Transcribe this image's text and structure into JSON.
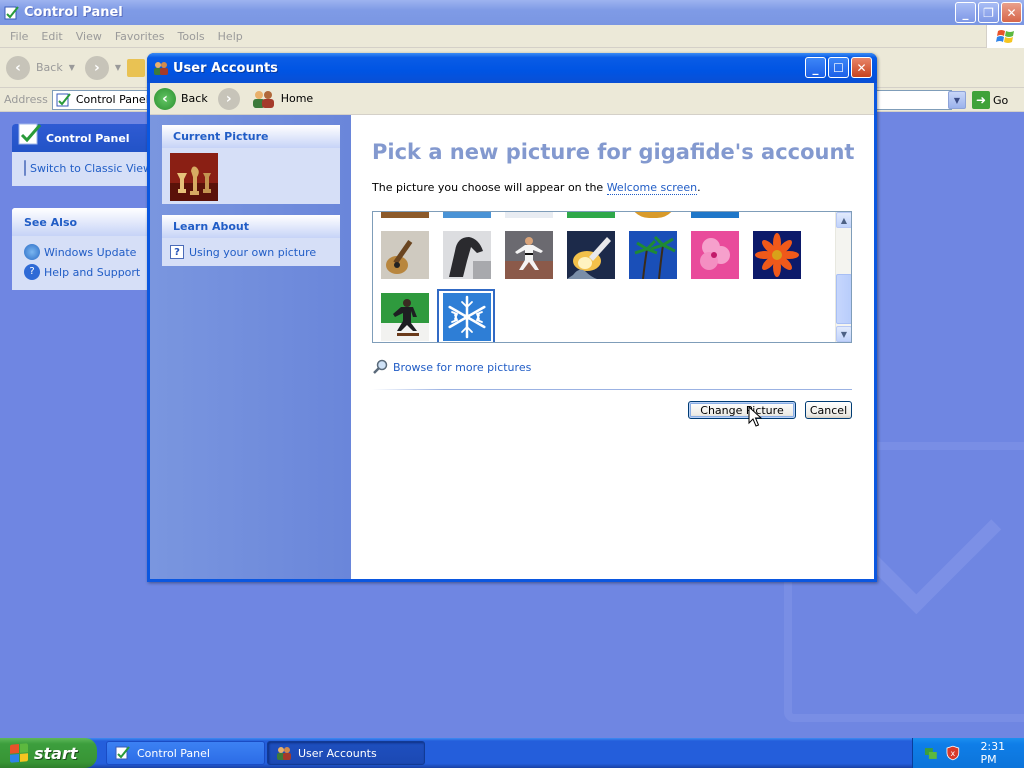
{
  "control_panel": {
    "title": "Control Panel",
    "menu": [
      "File",
      "Edit",
      "View",
      "Favorites",
      "Tools",
      "Help"
    ],
    "toolbar_back": "Back",
    "address_label": "Address",
    "address_value": "Control Panel",
    "go_label": "Go",
    "side_panel_title": "Control Panel",
    "switch_view_link": "Switch to Classic View",
    "see_also_title": "See Also",
    "see_also_links": [
      "Windows Update",
      "Help and Support"
    ]
  },
  "user_accounts": {
    "title": "User Accounts",
    "nav_back": "Back",
    "nav_home": "Home",
    "current_picture_header": "Current Picture",
    "learn_about_header": "Learn About",
    "learn_about_link": "Using your own picture",
    "heading": "Pick a new picture for gigafide's account",
    "description_prefix": "The picture you choose will appear on the ",
    "description_link": "Welcome screen",
    "description_suffix": ".",
    "pictures": [
      "guitar",
      "horse",
      "karate",
      "space-shuttle",
      "palm-trees",
      "pink-flower",
      "orange-flower",
      "skateboarder",
      "snowflake"
    ],
    "selected_picture": "snowflake",
    "browse_link": "Browse for more pictures",
    "change_button": "Change Picture",
    "cancel_button": "Cancel"
  },
  "taskbar": {
    "start_label": "start",
    "tasks": [
      "Control Panel",
      "User Accounts"
    ],
    "active_task": "User Accounts",
    "clock": "2:31 PM"
  },
  "colors": {
    "xp_blue": "#0054e3",
    "link_blue": "#215dc6",
    "heading_blue": "#8399cf",
    "start_green": "#3c9e3d"
  }
}
